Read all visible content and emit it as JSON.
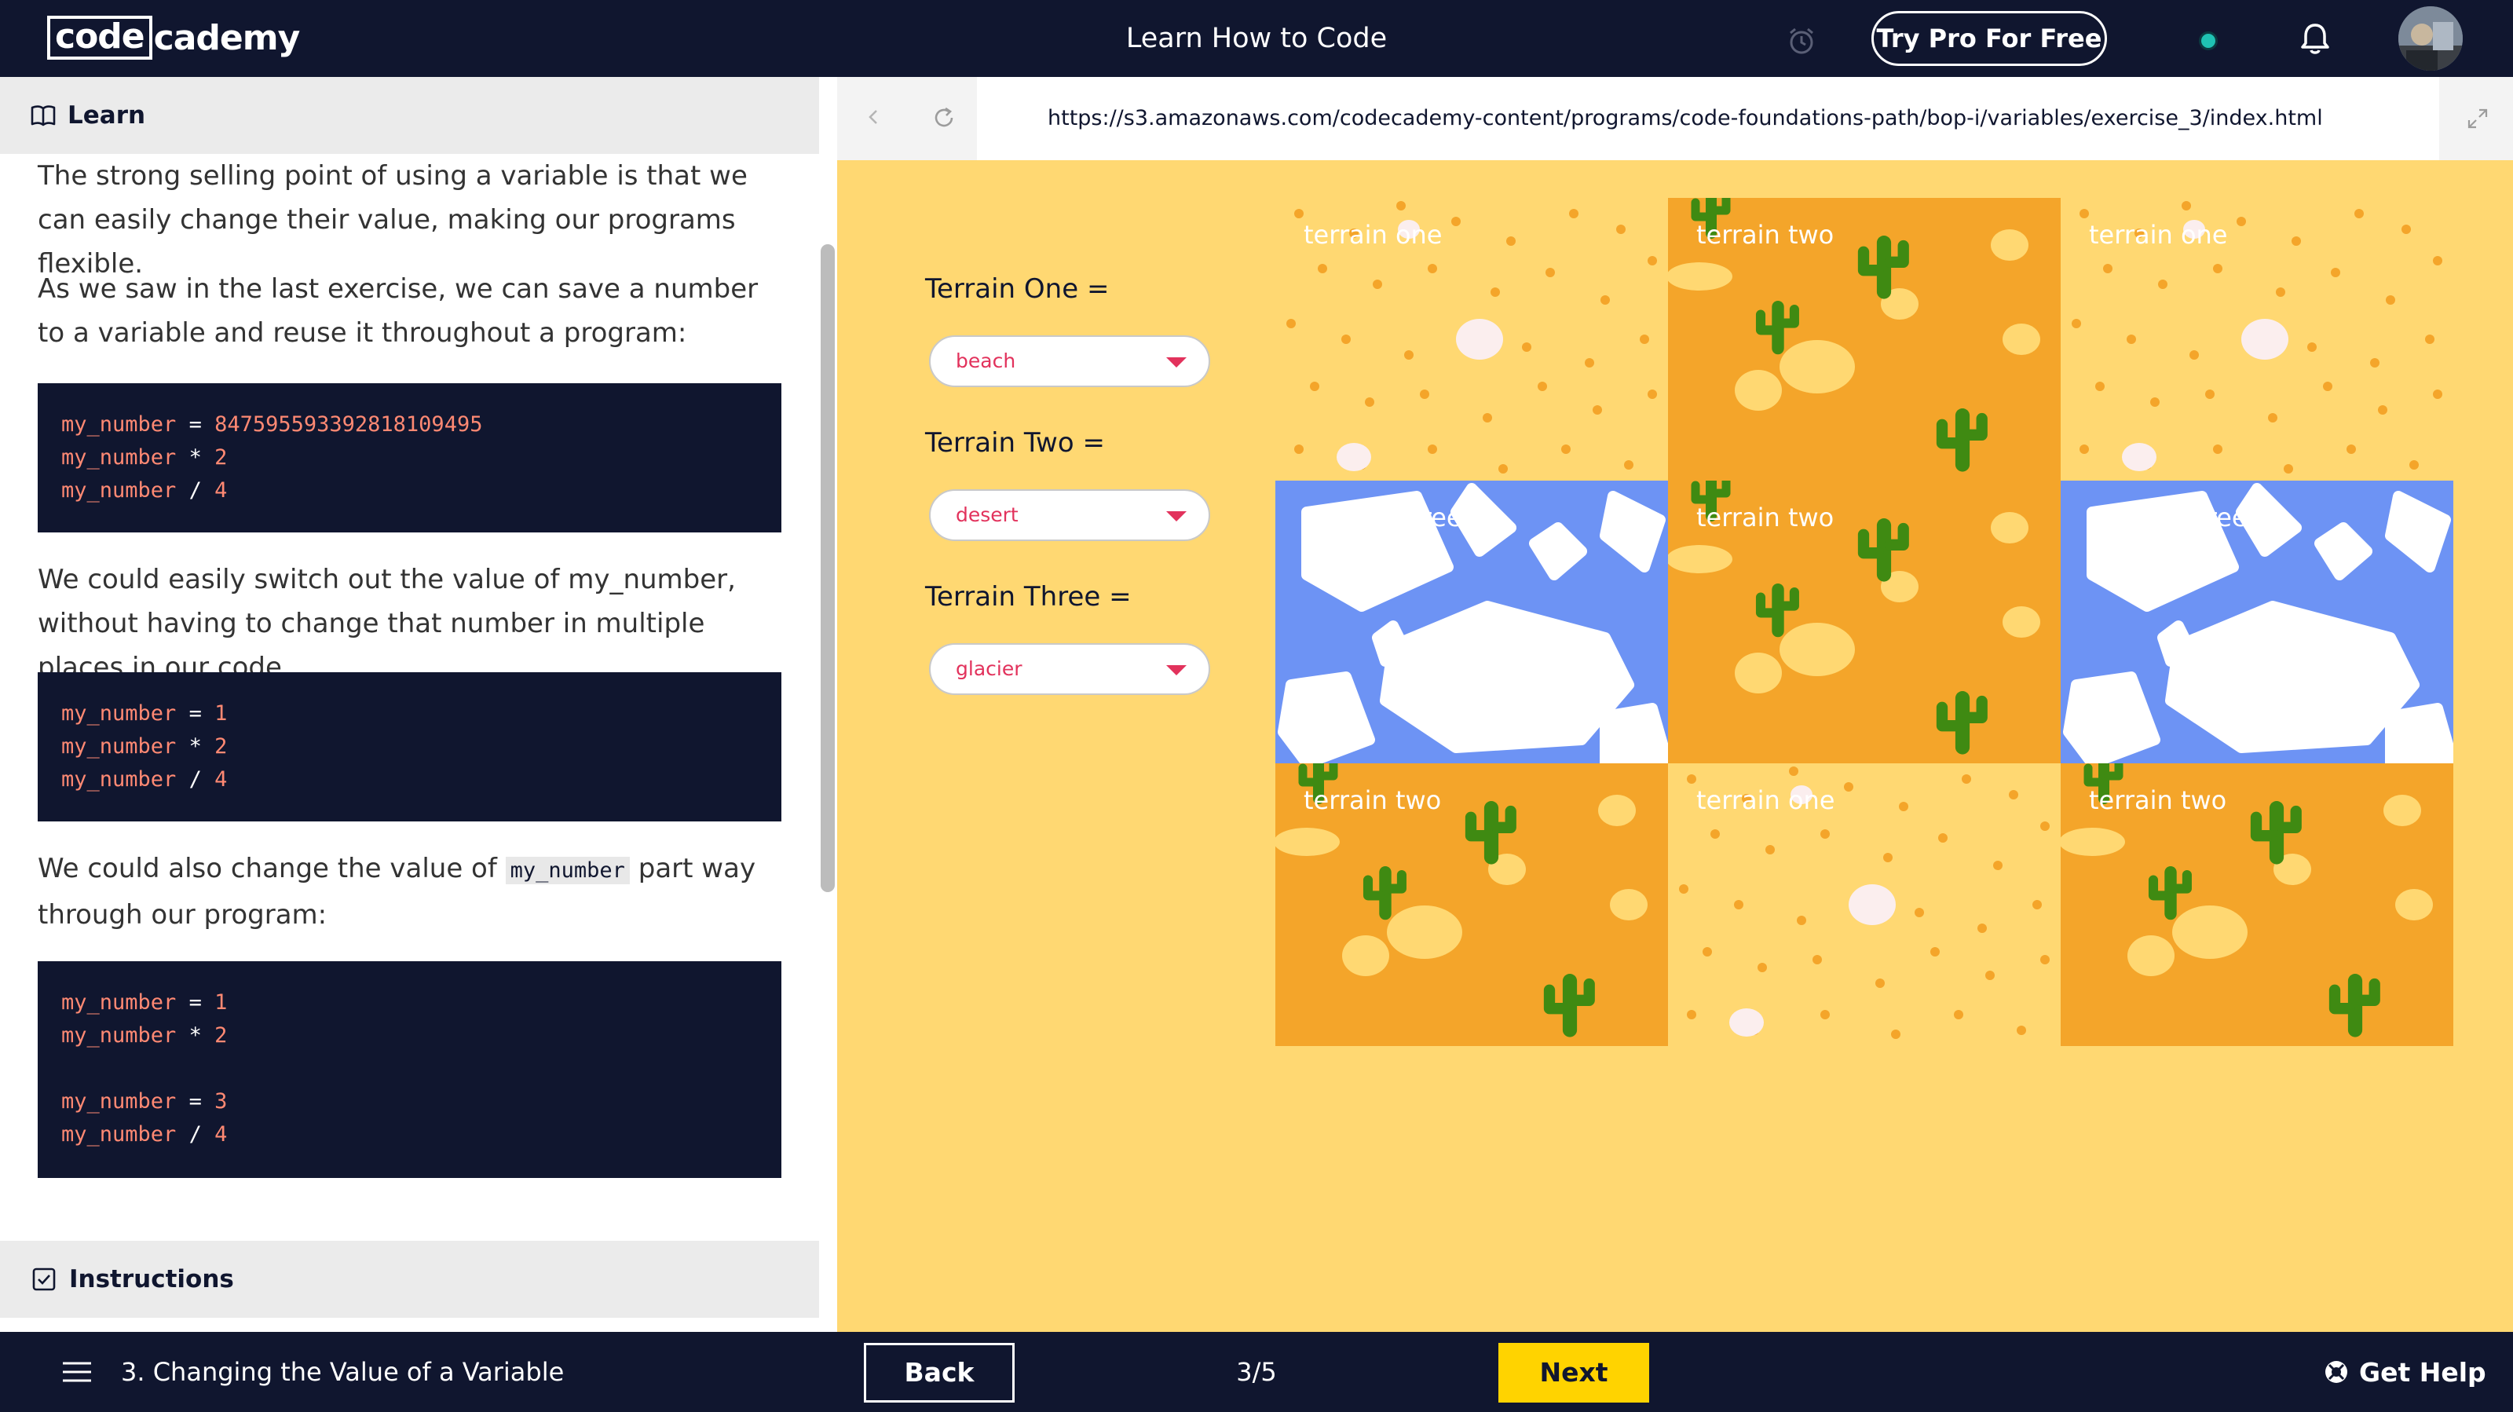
{
  "nav": {
    "logo_boxed": "code",
    "logo_rest": "cademy",
    "title": "Learn How to Code",
    "try_pro": "Try Pro For Free"
  },
  "left": {
    "learn_label": "Learn",
    "para1": "The strong selling point of using a variable is that we can easily change their value, making our programs flexible.",
    "para2": "As we saw in the last exercise, we can save a number to a variable and reuse it throughout a program:",
    "code1": [
      {
        "var": "my_number",
        "op": " = ",
        "num": "847595593392818109495"
      },
      {
        "var": "my_number",
        "op": " * ",
        "num": "2"
      },
      {
        "var": "my_number",
        "op": " / ",
        "num": "4"
      }
    ],
    "para3": "We could easily switch out the value of my_number, without having to change that number in multiple places in our code.",
    "code2": [
      {
        "var": "my_number",
        "op": " = ",
        "num": "1"
      },
      {
        "var": "my_number",
        "op": " * ",
        "num": "2"
      },
      {
        "var": "my_number",
        "op": " / ",
        "num": "4"
      }
    ],
    "para4_before": "We could also change the value of ",
    "para4_code": "my_number",
    "para4_after": " part way through our program:",
    "code3": [
      {
        "var": "my_number",
        "op": " = ",
        "num": "1"
      },
      {
        "var": "my_number",
        "op": " * ",
        "num": "2"
      },
      {
        "var": "",
        "op": "",
        "num": ""
      },
      {
        "var": "my_number",
        "op": " = ",
        "num": "3"
      },
      {
        "var": "my_number",
        "op": " / ",
        "num": "4"
      }
    ],
    "instructions_label": "Instructions"
  },
  "browser": {
    "url": "https://s3.amazonaws.com/codecademy-content/programs/code-foundations-path/bop-i/variables/exercise_3/index.html"
  },
  "terrain": {
    "label1": "Terrain One =",
    "select1": "beach",
    "label2": "Terrain Two =",
    "select2": "desert",
    "label3": "Terrain Three =",
    "select3": "glacier",
    "tiles": [
      {
        "type": "beach",
        "name": "terrain one"
      },
      {
        "type": "desert",
        "name": "terrain two"
      },
      {
        "type": "beach",
        "name": "terrain one"
      },
      {
        "type": "glacier",
        "name": "terrain three"
      },
      {
        "type": "desert",
        "name": "terrain two"
      },
      {
        "type": "glacier",
        "name": "terrain three"
      },
      {
        "type": "desert",
        "name": "terrain two"
      },
      {
        "type": "beach",
        "name": "terrain one"
      },
      {
        "type": "desert",
        "name": "terrain two"
      }
    ],
    "colors": {
      "beach": "#ffd872",
      "desert": "#f4a52a",
      "glacier": "#6d93f4"
    }
  },
  "bottom": {
    "lesson_title": "3. Changing the Value of a Variable",
    "back": "Back",
    "progress": "3/5",
    "next": "Next",
    "help": "Get Help"
  }
}
